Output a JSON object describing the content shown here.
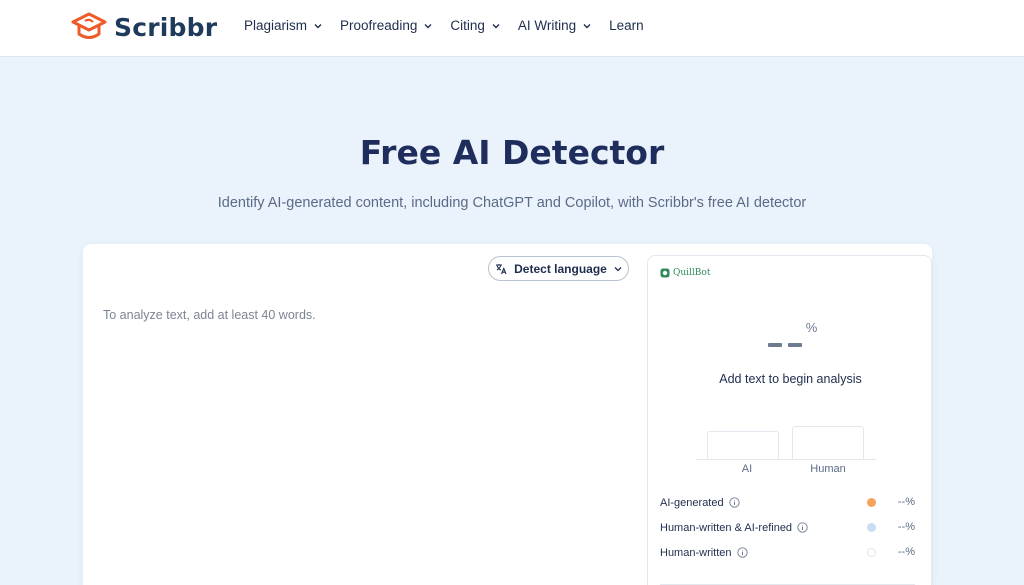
{
  "header": {
    "logo_text": "Scribbr",
    "nav": [
      {
        "label": "Plagiarism",
        "has_dropdown": true
      },
      {
        "label": "Proofreading",
        "has_dropdown": true
      },
      {
        "label": "Citing",
        "has_dropdown": true
      },
      {
        "label": "AI Writing",
        "has_dropdown": true
      },
      {
        "label": "Learn",
        "has_dropdown": false
      }
    ]
  },
  "hero": {
    "title": "Free AI Detector",
    "subtitle": "Identify AI-generated content, including ChatGPT and Copilot, with Scribbr's free AI detector"
  },
  "editor": {
    "detect_language_label": "Detect language",
    "placeholder": "To analyze text, add at least 40 words."
  },
  "result": {
    "brand": "QuillBot",
    "score_percent_symbol": "%",
    "message": "Add text to begin analysis",
    "bars": [
      {
        "label": "AI"
      },
      {
        "label": "Human"
      }
    ],
    "legend": [
      {
        "label": "AI-generated",
        "value": "--%",
        "color": "#f5a35c"
      },
      {
        "label": "Human-written & AI-refined",
        "value": "--%",
        "color": "#c9dcf5"
      },
      {
        "label": "Human-written",
        "value": "--%",
        "color": "#ffffff"
      }
    ]
  },
  "colors": {
    "brand_orange": "#ef5a2a",
    "brand_navy": "#1f3b5b",
    "page_background": "#eaf2fb",
    "quillbot_green": "#2e8b57"
  }
}
